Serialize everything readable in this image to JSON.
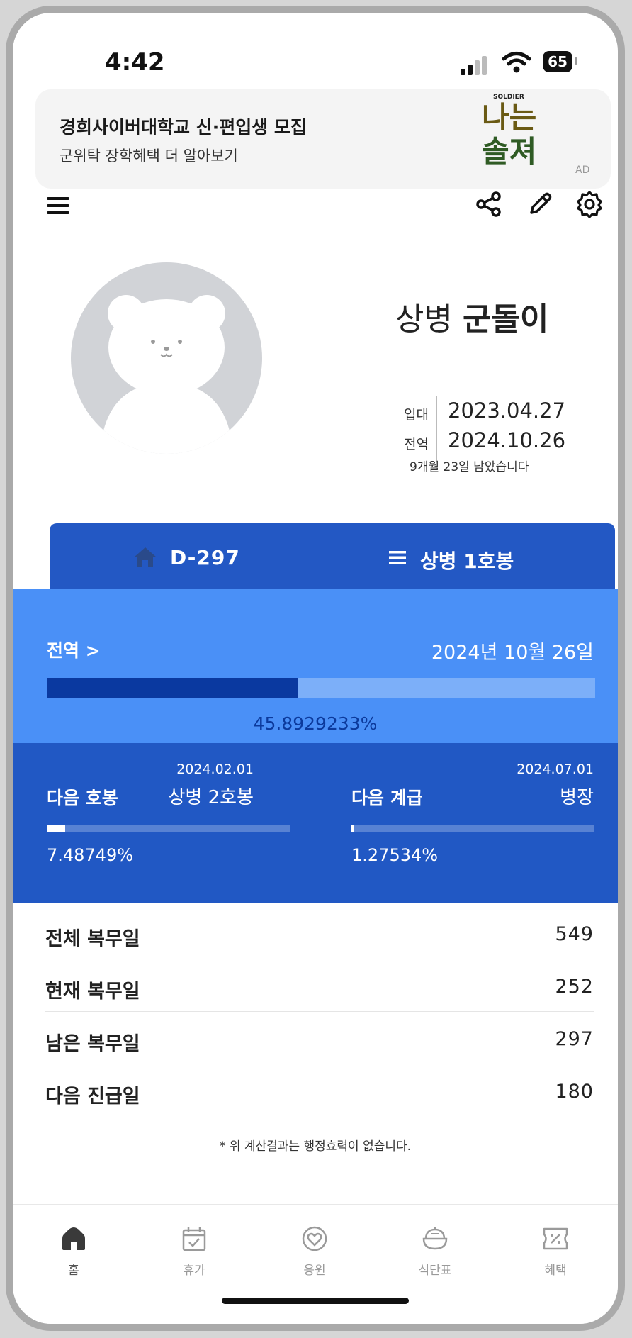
{
  "status_bar": {
    "time": "4:42",
    "battery": "65"
  },
  "ad": {
    "title": "경희사이버대학교 신·편입생 모집",
    "subtitle": "군위탁 장학혜택 더 알아보기",
    "logo_small": "SOLDIER",
    "logo_text_1": "나는",
    "logo_text_2": "솔져",
    "badge": "AD"
  },
  "toolbar": {
    "icons": [
      "menu-icon",
      "share-icon",
      "edit-icon",
      "settings-icon"
    ]
  },
  "profile": {
    "rank": "상병",
    "name": "군돌이",
    "enlist_label": "입대",
    "enlist_date": "2023.04.27",
    "discharge_label": "전역",
    "discharge_date": "2024.10.26",
    "remaining_text": "9개월 23일 남았습니다"
  },
  "tabs": {
    "dday": "D-297",
    "rank_step": "상병 1호봉"
  },
  "discharge_progress": {
    "title": "전역 >",
    "date": "2024년 10월 26일",
    "percent_text": "45.8929233%",
    "percent": 45.8929233
  },
  "next_step": {
    "title": "다음 호봉",
    "date": "2024.02.01",
    "target": "상병 2호봉",
    "percent_text": "7.48749%",
    "percent": 7.48749
  },
  "next_rank": {
    "title": "다음 계급",
    "date": "2024.07.01",
    "target": "병장",
    "percent_text": "1.27534%",
    "percent": 1.27534
  },
  "stats": [
    {
      "label": "전체 복무일",
      "value": "549"
    },
    {
      "label": "현재 복무일",
      "value": "252"
    },
    {
      "label": "남은 복무일",
      "value": "297"
    },
    {
      "label": "다음 진급일",
      "value": "180"
    }
  ],
  "note": "* 위 계산결과는 행정효력이 없습니다.",
  "bottom_nav": [
    {
      "label": "홈",
      "icon": "home-icon",
      "active": true
    },
    {
      "label": "휴가",
      "icon": "calendar-check-icon",
      "active": false
    },
    {
      "label": "응원",
      "icon": "heart-icon",
      "active": false
    },
    {
      "label": "식단표",
      "icon": "rice-bowl-icon",
      "active": false
    },
    {
      "label": "혜택",
      "icon": "ticket-icon",
      "active": false
    }
  ],
  "colors": {
    "tab_blue": "#2358c4",
    "progress_section": "#4a90f7",
    "progress_fill": "#0a39a0",
    "next_section": "#2158c4"
  }
}
